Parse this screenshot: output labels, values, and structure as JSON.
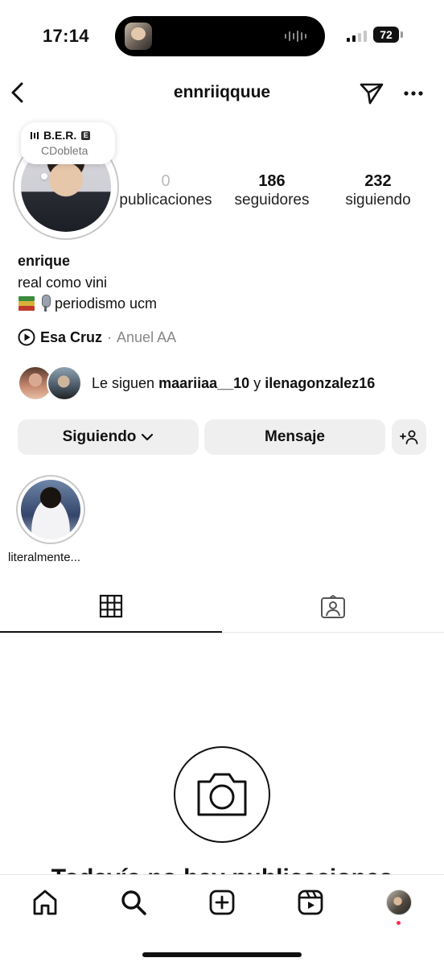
{
  "status_bar": {
    "time": "17:14",
    "battery": "72"
  },
  "header": {
    "username": "ennriiqquue"
  },
  "note": {
    "title": "B.E.R.",
    "subtitle": "CDobleta"
  },
  "stats": {
    "posts_count": "0",
    "posts_label": "publicaciones",
    "followers_count": "186",
    "followers_label": "seguidores",
    "following_count": "232",
    "following_label": "siguiendo"
  },
  "profile": {
    "display_name": "enrique",
    "bio_line1": "real como vini",
    "bio_line2": "periodismo ucm"
  },
  "music": {
    "song": "Esa Cruz",
    "separator": "·",
    "artist": "Anuel AA"
  },
  "followed_by": {
    "prefix": "Le siguen",
    "user1": "maariiaa__10",
    "conjunction": "y",
    "user2": "ilenagonzalez16"
  },
  "actions": {
    "following_label": "Siguiendo",
    "message_label": "Mensaje"
  },
  "highlights": [
    {
      "label": "literalmente..."
    }
  ],
  "empty_state": {
    "title": "Todavía no hay publicaciones"
  },
  "colors": {
    "notification_dot": "#ff2d55",
    "button_bg": "#efefef"
  },
  "icons": {
    "back": "chevron-left-icon",
    "send": "paper-plane-icon",
    "more": "ellipsis-icon",
    "grid": "grid-icon",
    "tagged": "tagged-person-icon",
    "camera": "camera-icon",
    "home": "home-icon",
    "search": "search-icon",
    "create": "plus-square-icon",
    "reels": "reels-icon"
  }
}
